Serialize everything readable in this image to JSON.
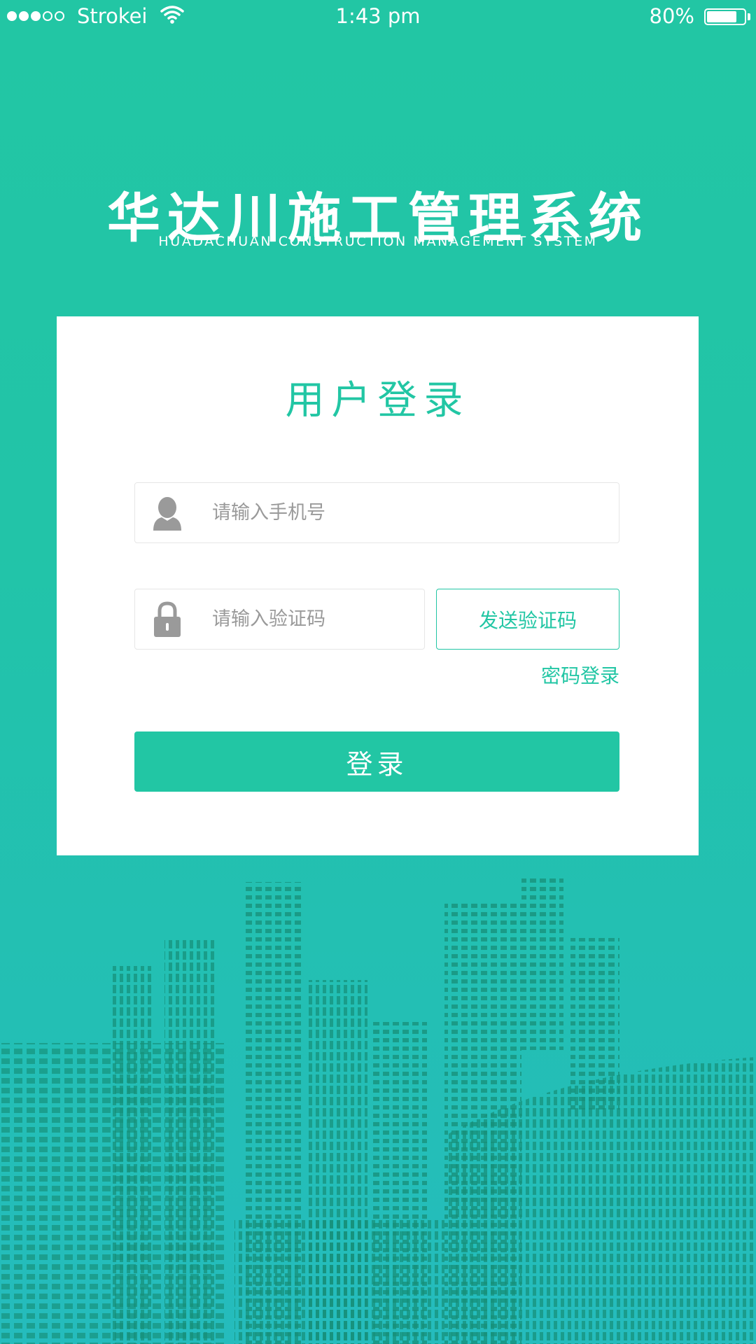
{
  "status_bar": {
    "carrier": "Strokei",
    "time": "1:43 pm",
    "battery": "80%",
    "battery_level": 0.8,
    "signal_bars_filled": 3,
    "signal_bars_total": 5
  },
  "header": {
    "title": "华达川施工管理系统",
    "subtitle": "HUADACHUAN CONSTRUCTION MANAGEMENT SYSTEM"
  },
  "login_card": {
    "title": "用户登录",
    "phone_placeholder": "请输入手机号",
    "code_placeholder": "请输入验证码",
    "send_code_label": "发送验证码",
    "password_login_label": "密码登录",
    "login_button_label": "登录"
  },
  "colors": {
    "accent": "#22c6a4",
    "skyline": "#168f78"
  },
  "icons": {
    "phone_field": "user-icon",
    "code_field": "lock-icon"
  }
}
